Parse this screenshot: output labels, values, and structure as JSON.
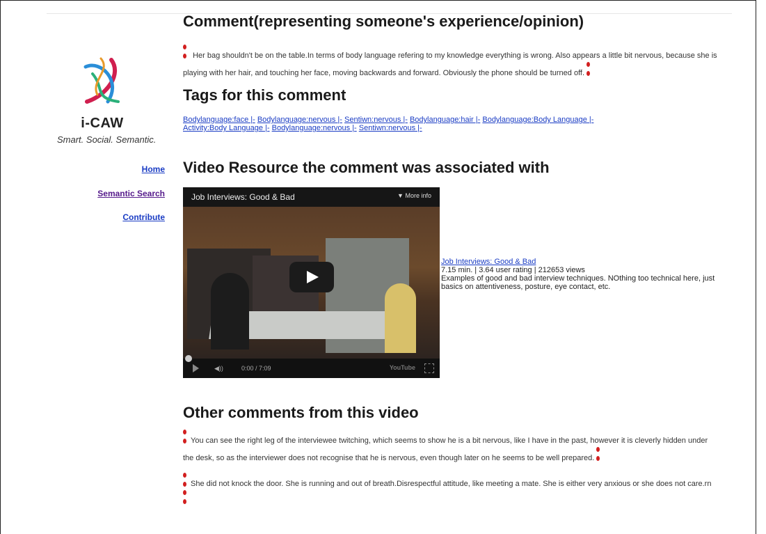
{
  "brand": {
    "name": "i-CAW",
    "tagline": "Smart. Social. Semantic."
  },
  "nav": {
    "home": "Home",
    "semantic_search": "Semantic Search",
    "contribute": "Contribute"
  },
  "sections": {
    "comment_heading": "Comment(representing someone's experience/opinion)",
    "tags_heading": "Tags for this comment",
    "video_heading": "Video Resource the comment was associated with",
    "other_heading": "Other comments from this video"
  },
  "comment": {
    "text": "Her bag shouldn't be on the table.In terms of body language refering to my knowledge everything is wrong. Also appears a little bit nervous, because she is playing with her hair, and touching her face, moving backwards and forward. Obviously the phone should be turned off."
  },
  "tags": [
    "Bodylanguage:face |-",
    "Bodylanguage:nervous |-",
    "Sentiwn:nervous |-",
    "Bodylanguage:hair |-",
    "Bodylanguage:Body Language |-",
    "Activity:Body Language |-",
    "Bodylanguage:nervous |-",
    "Sentiwn:nervous |-"
  ],
  "video": {
    "player_title": "Job Interviews: Good & Bad",
    "more_info": "More info",
    "time": "0:00 / 7:09",
    "youtube_label": "YouTube",
    "link_title": "Job Interviews: Good & Bad",
    "stats": "7.15 min. | 3.64 user rating | 212653 views",
    "description": "Examples of good and bad interview techniques. NOthing too technical here, just basics on attentiveness, posture, eye contact, etc."
  },
  "other_comments": [
    "You can see the right leg of the interviewee twitching, which seems to show he is a bit nervous, like I have in the past, however it is cleverly hidden under the desk, so as the interviewer does not recognise that he is nervous, even though later on he seems to be well prepared.",
    "She did not knock the door. She is running and out of breath.Disrespectful attitude, like meeting a mate. She is either very anxious or she does not care.rn"
  ],
  "colors": {
    "link": "#1a3cc4",
    "visited_link": "#551a8b",
    "quote": "#d21f1f"
  }
}
